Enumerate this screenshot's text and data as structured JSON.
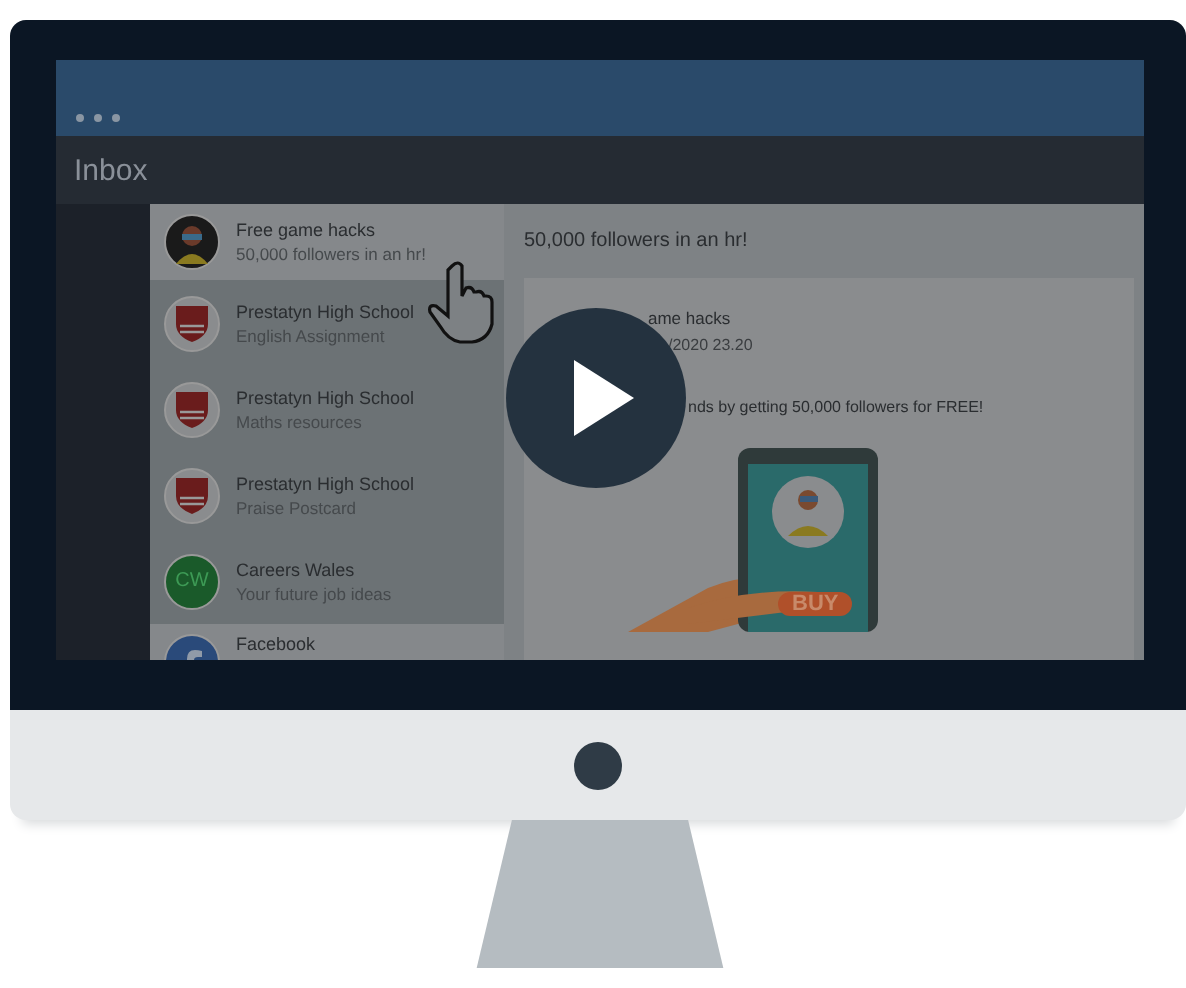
{
  "screen": {
    "title": "Inbox",
    "messages": [
      {
        "kind": "gamer",
        "sender": "Free game hacks",
        "subject": "50,000 followers in an hr!",
        "selected": true
      },
      {
        "kind": "crest",
        "sender": "Prestatyn High School",
        "subject": "English Assignment",
        "selected": false
      },
      {
        "kind": "crest",
        "sender": "Prestatyn High School",
        "subject": "Maths resources",
        "selected": false
      },
      {
        "kind": "crest",
        "sender": "Prestatyn High School",
        "subject": "Praise Postcard",
        "selected": false
      },
      {
        "kind": "initials",
        "initials": "CW",
        "sender": "Careers Wales",
        "subject": "Your future job ideas",
        "selected": false
      },
      {
        "kind": "facebook",
        "sender": "Facebook",
        "selected": true
      }
    ],
    "reading_pane": {
      "subject": "50,000 followers in an hr!",
      "sender": "ame hacks",
      "date": "/2020 23.20",
      "body": "nds by getting 50,000 followers for FREE!",
      "phone_button": "BUY"
    }
  }
}
